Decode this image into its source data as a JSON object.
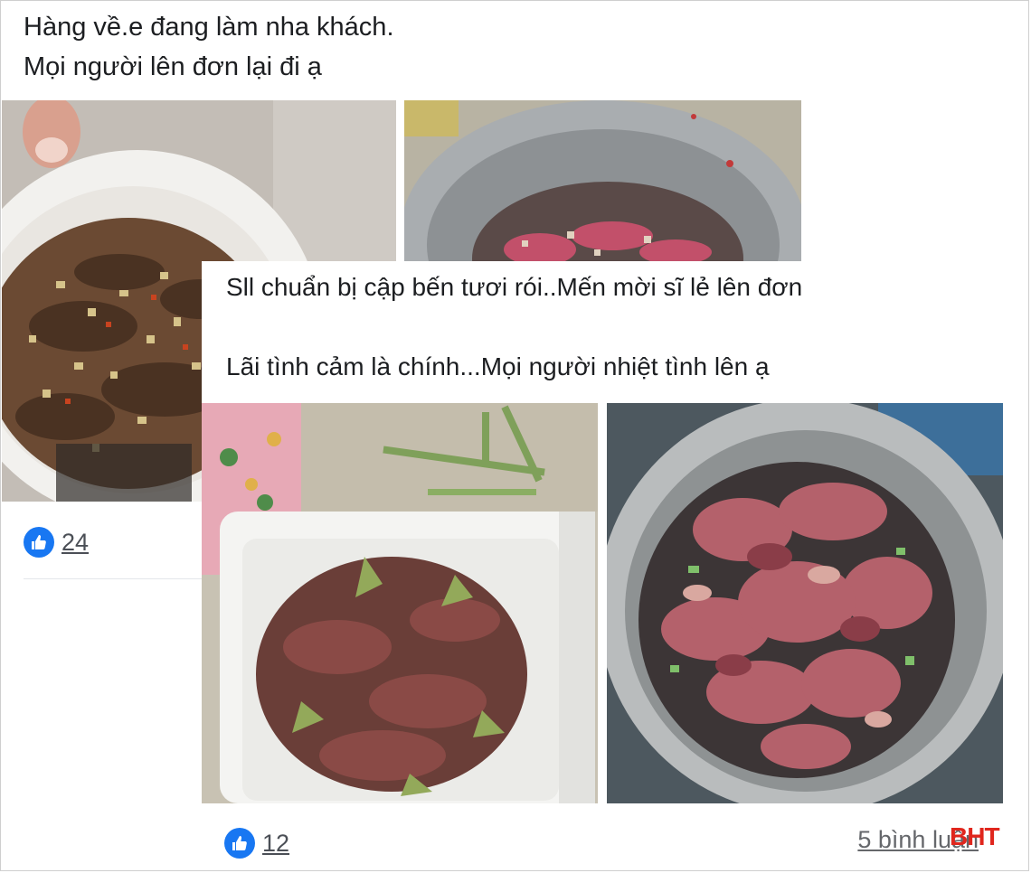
{
  "post1": {
    "line1": "Hàng về.e đang làm nha khách.",
    "line2": "Mọi người lên đơn lại đi ạ",
    "likes": "24",
    "like_icon": "thumbs-up-icon"
  },
  "post2": {
    "line1": "Sll chuẩn bị cập bến tươi rói..Mến mời sĩ lẻ lên đơn",
    "line2": "Lãi tình cảm là chính...Mọi người nhiệt tình lên ạ",
    "likes": "12",
    "comments": "5 bình luận",
    "like_icon": "thumbs-up-icon"
  },
  "watermark": {
    "text": "BHT",
    "color": "#e0261d"
  },
  "colors": {
    "accent": "#1877f2",
    "text": "#1c1e21",
    "muted": "#65676b"
  }
}
